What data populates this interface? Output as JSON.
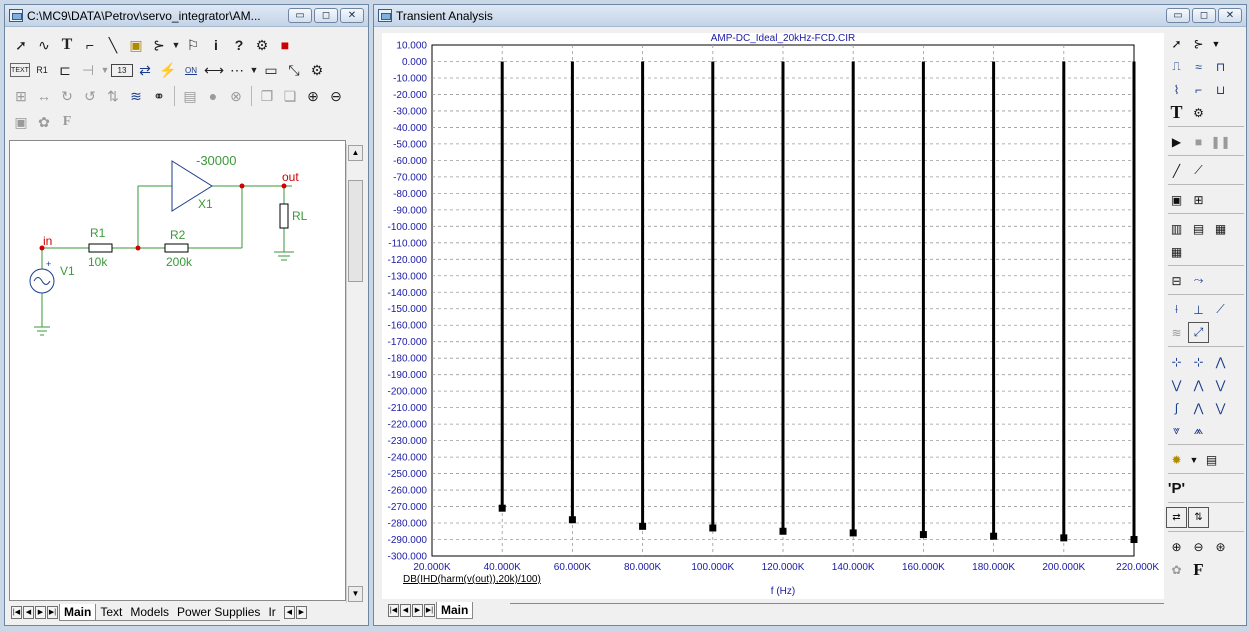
{
  "left_window": {
    "title": "C:\\MC9\\DATA\\Petrov\\servo_integrator\\AM...",
    "window_buttons": [
      "▭",
      "◻",
      "✕"
    ],
    "tabs": [
      {
        "label": "Main",
        "active": true
      },
      {
        "label": "Text",
        "active": false
      },
      {
        "label": "Models",
        "active": false
      },
      {
        "label": "Power Supplies",
        "active": false
      },
      {
        "label": "Ir",
        "active": false
      }
    ]
  },
  "toolbar": {
    "row1_icons": [
      "select-arrow-icon",
      "wire-icon",
      "text-tool-icon",
      "orthogonal-wire-icon",
      "diagonal-wire-icon",
      "bus-icon",
      "component-icon",
      "dropdown-icon",
      "flag-icon",
      "info-icon",
      "help-icon",
      "attribute-icon",
      "find-icon"
    ],
    "row2_label_text": "TEXT",
    "row2_label_on": "ON",
    "row2_label_13": "13"
  },
  "schematic": {
    "opamp_gain": "-30000",
    "opamp_name": "X1",
    "node_out": "out",
    "node_in": "in",
    "r1_name": "R1",
    "r1_value": "10k",
    "r2_name": "R2",
    "r2_value": "200k",
    "rl_name": "RL",
    "source_name": "V1"
  },
  "right_window": {
    "title": "Transient Analysis",
    "window_buttons": [
      "▭",
      "◻",
      "✕"
    ],
    "tabs": [
      {
        "label": "Main",
        "active": true
      }
    ]
  },
  "chart_data": {
    "type": "bar",
    "title": "AMP-DC_Ideal_20kHz-FCD.CIR",
    "xlabel": "f (Hz)",
    "ylabel": "DB(IHD(harm(v(out)),20k)/100)",
    "xlim": [
      20000,
      220000
    ],
    "ylim": [
      -300,
      10
    ],
    "x_ticks": [
      "20.000K",
      "40.000K",
      "60.000K",
      "80.000K",
      "100.000K",
      "120.000K",
      "140.000K",
      "160.000K",
      "180.000K",
      "200.000K",
      "220.000K"
    ],
    "y_ticks": [
      "10.000",
      "0.000",
      "-10.000",
      "-20.000",
      "-30.000",
      "-40.000",
      "-50.000",
      "-60.000",
      "-70.000",
      "-80.000",
      "-90.000",
      "-100.000",
      "-110.000",
      "-120.000",
      "-130.000",
      "-140.000",
      "-150.000",
      "-160.000",
      "-170.000",
      "-180.000",
      "-190.000",
      "-200.000",
      "-210.000",
      "-220.000",
      "-230.000",
      "-240.000",
      "-250.000",
      "-260.000",
      "-270.000",
      "-280.000",
      "-290.000",
      "-300.000"
    ],
    "grid": true,
    "series": [
      {
        "x": [
          40000,
          60000,
          80000,
          100000,
          120000,
          140000,
          160000,
          180000,
          200000,
          220000
        ],
        "y": [
          -271,
          -278,
          -282,
          -283,
          -285,
          -286,
          -287,
          -288,
          -289,
          -290
        ]
      }
    ],
    "colors": {
      "axis_text": "#1a1aa6",
      "bar": "#000000",
      "grid": "#9a9a9a"
    }
  },
  "right_toolbar": {
    "letter_p": "'P'",
    "letter_t": "T",
    "letter_f": "F"
  }
}
